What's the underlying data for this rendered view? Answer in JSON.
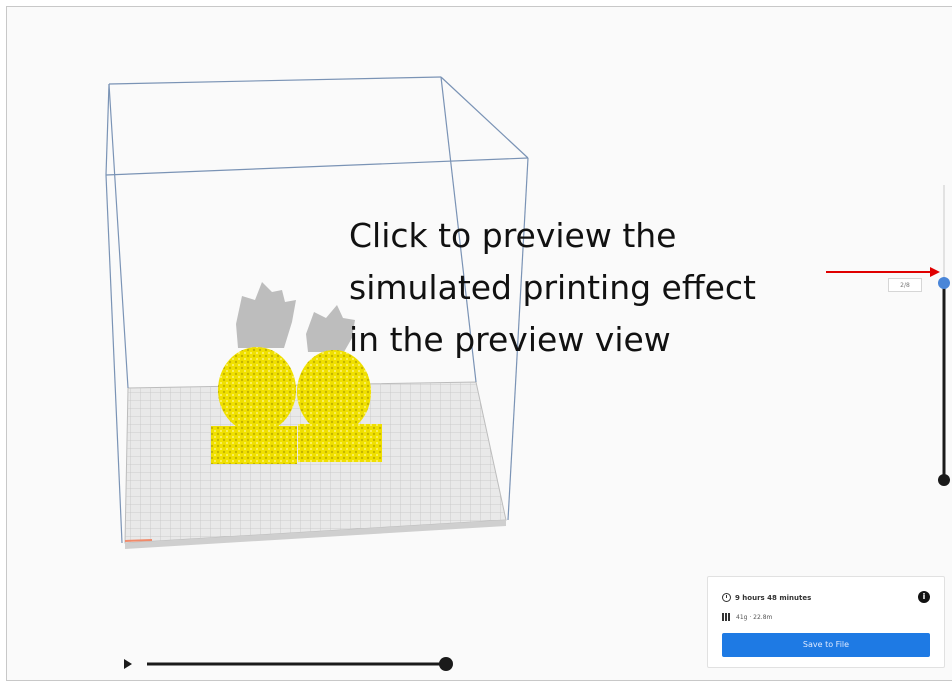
{
  "annotation": {
    "lines": [
      "Click to preview the",
      "simulated printing effect",
      "in the preview view"
    ]
  },
  "layer_slider": {
    "current_layer_label": "2/8"
  },
  "print_panel": {
    "estimated_time": "9 hours 48 minutes",
    "material": "41g · 22.8m",
    "save_button_label": "Save to File"
  },
  "colors": {
    "model": "#f0e000",
    "build_volume": "#6f8fb0",
    "slider_accent": "#4a86d8",
    "annotation_arrow": "#e00000",
    "save_button": "#1e7ae4"
  },
  "icons": {
    "time": "clock-icon",
    "info": "info-icon",
    "material": "spool-icon",
    "play": "play-icon"
  }
}
